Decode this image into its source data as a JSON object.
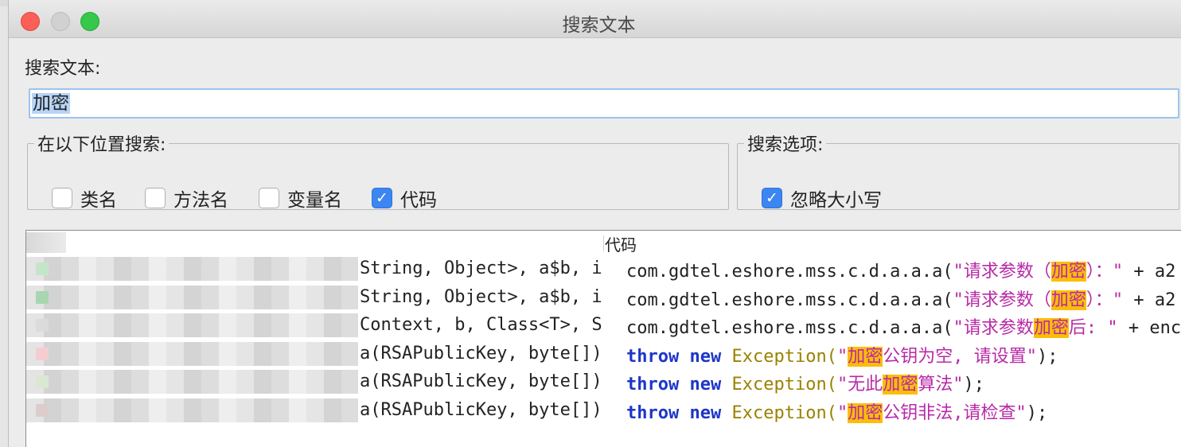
{
  "window": {
    "title": "搜索文本"
  },
  "search": {
    "label": "搜索文本:",
    "value": "加密"
  },
  "location_group": {
    "legend": "在以下位置搜索:",
    "options": [
      {
        "label": "类名",
        "checked": false
      },
      {
        "label": "方法名",
        "checked": false
      },
      {
        "label": "变量名",
        "checked": false
      },
      {
        "label": "代码",
        "checked": true
      }
    ]
  },
  "options_group": {
    "legend": "搜索选项:",
    "options": [
      {
        "label": "忽略大小写",
        "checked": true
      }
    ]
  },
  "results": {
    "code_column_header": "代码",
    "rows": [
      {
        "signature": "String, Object>, a$b, in",
        "code": [
          {
            "t": "com.gdtel.eshore.mss.c.d.a.a.a(",
            "s": "norm"
          },
          {
            "t": "\"请求参数（",
            "s": "str"
          },
          {
            "t": "加密",
            "s": "hl"
          },
          {
            "t": "）：\"",
            "s": "str"
          },
          {
            "t": " + a2",
            "s": "norm"
          }
        ]
      },
      {
        "signature": "String, Object>, a$b, in",
        "code": [
          {
            "t": "com.gdtel.eshore.mss.c.d.a.a.a(",
            "s": "norm"
          },
          {
            "t": "\"请求参数（",
            "s": "str"
          },
          {
            "t": "加密",
            "s": "hl"
          },
          {
            "t": "）：\"",
            "s": "str"
          },
          {
            "t": " + a2",
            "s": "norm"
          }
        ]
      },
      {
        "signature": "Context, b, Class<T>, St",
        "code": [
          {
            "t": "com.gdtel.eshore.mss.c.d.a.a.a(",
            "s": "norm"
          },
          {
            "t": "\"请求参数",
            "s": "str"
          },
          {
            "t": "加密",
            "s": "hl"
          },
          {
            "t": "后: \"",
            "s": "str"
          },
          {
            "t": " + enco",
            "s": "norm"
          }
        ]
      },
      {
        "signature": "a(RSAPublicKey, byte[])",
        "code": [
          {
            "t": "throw",
            "s": "kw"
          },
          {
            "t": " ",
            "s": "norm"
          },
          {
            "t": "new",
            "s": "kw"
          },
          {
            "t": " Exception(",
            "s": "exc"
          },
          {
            "t": "\"",
            "s": "str"
          },
          {
            "t": "加密",
            "s": "hl"
          },
          {
            "t": "公钥为空, 请设置\"",
            "s": "str"
          },
          {
            "t": ");",
            "s": "norm"
          }
        ]
      },
      {
        "signature": "a(RSAPublicKey, byte[])",
        "code": [
          {
            "t": "throw",
            "s": "kw"
          },
          {
            "t": " ",
            "s": "norm"
          },
          {
            "t": "new",
            "s": "kw"
          },
          {
            "t": " Exception(",
            "s": "exc"
          },
          {
            "t": "\"无此",
            "s": "str"
          },
          {
            "t": "加密",
            "s": "hl"
          },
          {
            "t": "算法\"",
            "s": "str"
          },
          {
            "t": ");",
            "s": "norm"
          }
        ]
      },
      {
        "signature": "a(RSAPublicKey, byte[])",
        "code": [
          {
            "t": "throw",
            "s": "kw"
          },
          {
            "t": " ",
            "s": "norm"
          },
          {
            "t": "new",
            "s": "kw"
          },
          {
            "t": " Exception(",
            "s": "exc"
          },
          {
            "t": "\"",
            "s": "str"
          },
          {
            "t": "加密",
            "s": "hl"
          },
          {
            "t": "公钥非法,请检查\"",
            "s": "str"
          },
          {
            "t": ");",
            "s": "norm"
          }
        ]
      }
    ]
  },
  "colors": {
    "string": "#b82aa6",
    "keyword": "#1d36c8",
    "exception": "#9a8200",
    "highlight": "#fbbd08",
    "checkbox_checked": "#3b86f0"
  },
  "icons": [
    "close-window-icon",
    "minimize-window-icon",
    "maximize-window-icon",
    "checkmark-icon"
  ]
}
